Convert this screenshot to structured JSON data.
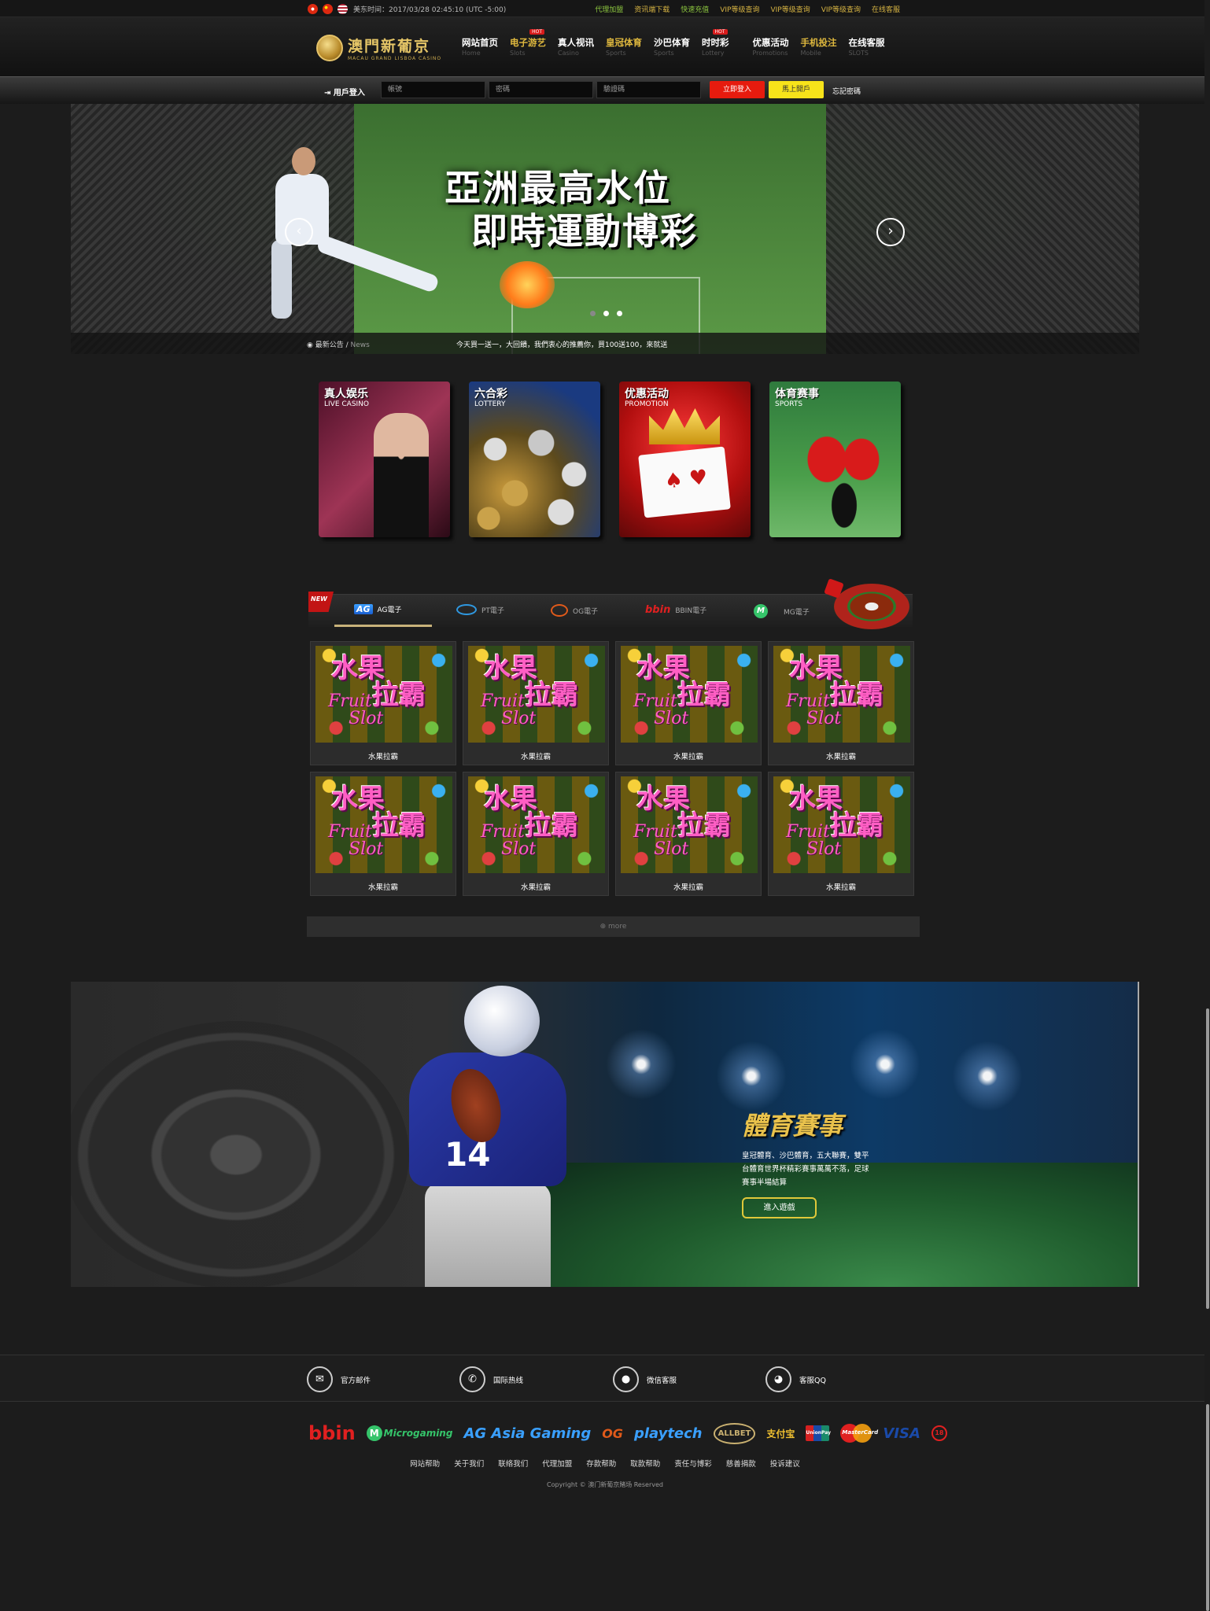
{
  "topbar": {
    "time": "美东时间：2017/03/28 02:45:10 (UTC -5:00)",
    "links": [
      "代理加盟",
      "资讯端下载",
      "快速充值",
      "VIP等级查询",
      "VIP等级查询",
      "VIP等级查询",
      "在线客服"
    ]
  },
  "logo": {
    "cn": "澳門新葡京",
    "en": "MACAU GRAND LISBOA CASINO"
  },
  "nav": [
    {
      "cn": "网站首页",
      "en": "Home",
      "hot": ""
    },
    {
      "cn": "电子游艺",
      "en": "Slots",
      "hot": "HOT"
    },
    {
      "cn": "真人视讯",
      "en": "Casino",
      "hot": ""
    },
    {
      "cn": "皇冠体育",
      "en": "Sports",
      "hot": ""
    },
    {
      "cn": "沙巴体育",
      "en": "Sports",
      "hot": ""
    },
    {
      "cn": "时时彩",
      "en": "Lottery",
      "hot": "HOT"
    },
    {
      "cn": "优惠活动",
      "en": "Promotions",
      "hot": ""
    },
    {
      "cn": "手机投注",
      "en": "Mobile",
      "hot": ""
    },
    {
      "cn": "在线客服",
      "en": "SLOTS",
      "hot": ""
    }
  ],
  "login": {
    "label": "用戶登入",
    "account_placeholder": "帳號",
    "password_placeholder": "密碼",
    "captcha_placeholder": "驗證碼",
    "login_button": "立即登入",
    "register_button": "馬上開戶",
    "forgot": "忘記密碼"
  },
  "banner": {
    "title_line1": "亞洲最高水位",
    "title_line2": "即時運動博彩",
    "prev": "‹",
    "next": "›",
    "slides": 3,
    "active_slide": 1
  },
  "news": {
    "label": "最新公告",
    "label_en": "News",
    "text": "今天買一送一，大回饋，我們衷心的推薦你，買100送100，來就送"
  },
  "categories": [
    {
      "cn": "真人娱乐",
      "en": "LIVE CASINO"
    },
    {
      "cn": "六合彩",
      "en": "LOTTERY"
    },
    {
      "cn": "优惠活动",
      "en": "PROMOTION"
    },
    {
      "cn": "体育赛事",
      "en": "SPORTS"
    }
  ],
  "game_tabs": {
    "new_badge": "NEW",
    "tabs": [
      {
        "icon": "ag-logo-icon",
        "label": "AG電子"
      },
      {
        "icon": "pt-logo-icon",
        "label": "PT電子"
      },
      {
        "icon": "og-logo-icon",
        "label": "OG電子"
      },
      {
        "icon": "bbin-logo-icon",
        "label": "BBIN電子"
      },
      {
        "icon": "mg-logo-icon",
        "label": "MG電子"
      }
    ],
    "active_tab": 0
  },
  "games": [
    {
      "name": "水果拉霸"
    },
    {
      "name": "水果拉霸"
    },
    {
      "name": "水果拉霸"
    },
    {
      "name": "水果拉霸"
    },
    {
      "name": "水果拉霸"
    },
    {
      "name": "水果拉霸"
    },
    {
      "name": "水果拉霸"
    },
    {
      "name": "水果拉霸"
    }
  ],
  "game_thumb_text": {
    "cn_top": "水果",
    "cn_bottom": "拉霸",
    "en_top": "Fruit",
    "en_bottom": "Slot"
  },
  "more": "⊕ more",
  "promo": {
    "title": "體育賽事",
    "desc": "皇冠體育、沙巴體育，五大聯賽，雙平台體育世界杯精彩賽事萬萬不落，足球賽事半場結算",
    "button": "進入遊戲",
    "jersey_number": "14"
  },
  "contact": [
    {
      "icon": "mail-icon",
      "glyph": "✉",
      "label": "官方邮件"
    },
    {
      "icon": "phone-icon",
      "glyph": "✆",
      "label": "国际热线"
    },
    {
      "icon": "wechat-icon",
      "glyph": "●",
      "label": "微信客服"
    },
    {
      "icon": "qq-icon",
      "glyph": "◕",
      "label": "客服QQ"
    }
  ],
  "partners": {
    "bbin": "bbin",
    "mg": "Microgaming",
    "ag": "AG Asia Gaming",
    "og": "OG",
    "pt": "playtech",
    "allbet": "ALLBET",
    "alipay": "支付宝",
    "unionpay": "UnionPay",
    "mastercard": "MasterCard",
    "visa": "VISA",
    "age": "18"
  },
  "footer_links": [
    "网站帮助",
    "关于我们",
    "联络我们",
    "代理加盟",
    "存款帮助",
    "取款帮助",
    "责任与博彩",
    "慈善捐款",
    "投诉建议"
  ],
  "copyright": "Copyright © 澳门新葡京賭场 Reserved",
  "colors": {
    "gold": "#e0b93e",
    "login_red": "#e61b0e",
    "register_yellow": "#f7e31a",
    "accent_green": "#8cc63f"
  }
}
